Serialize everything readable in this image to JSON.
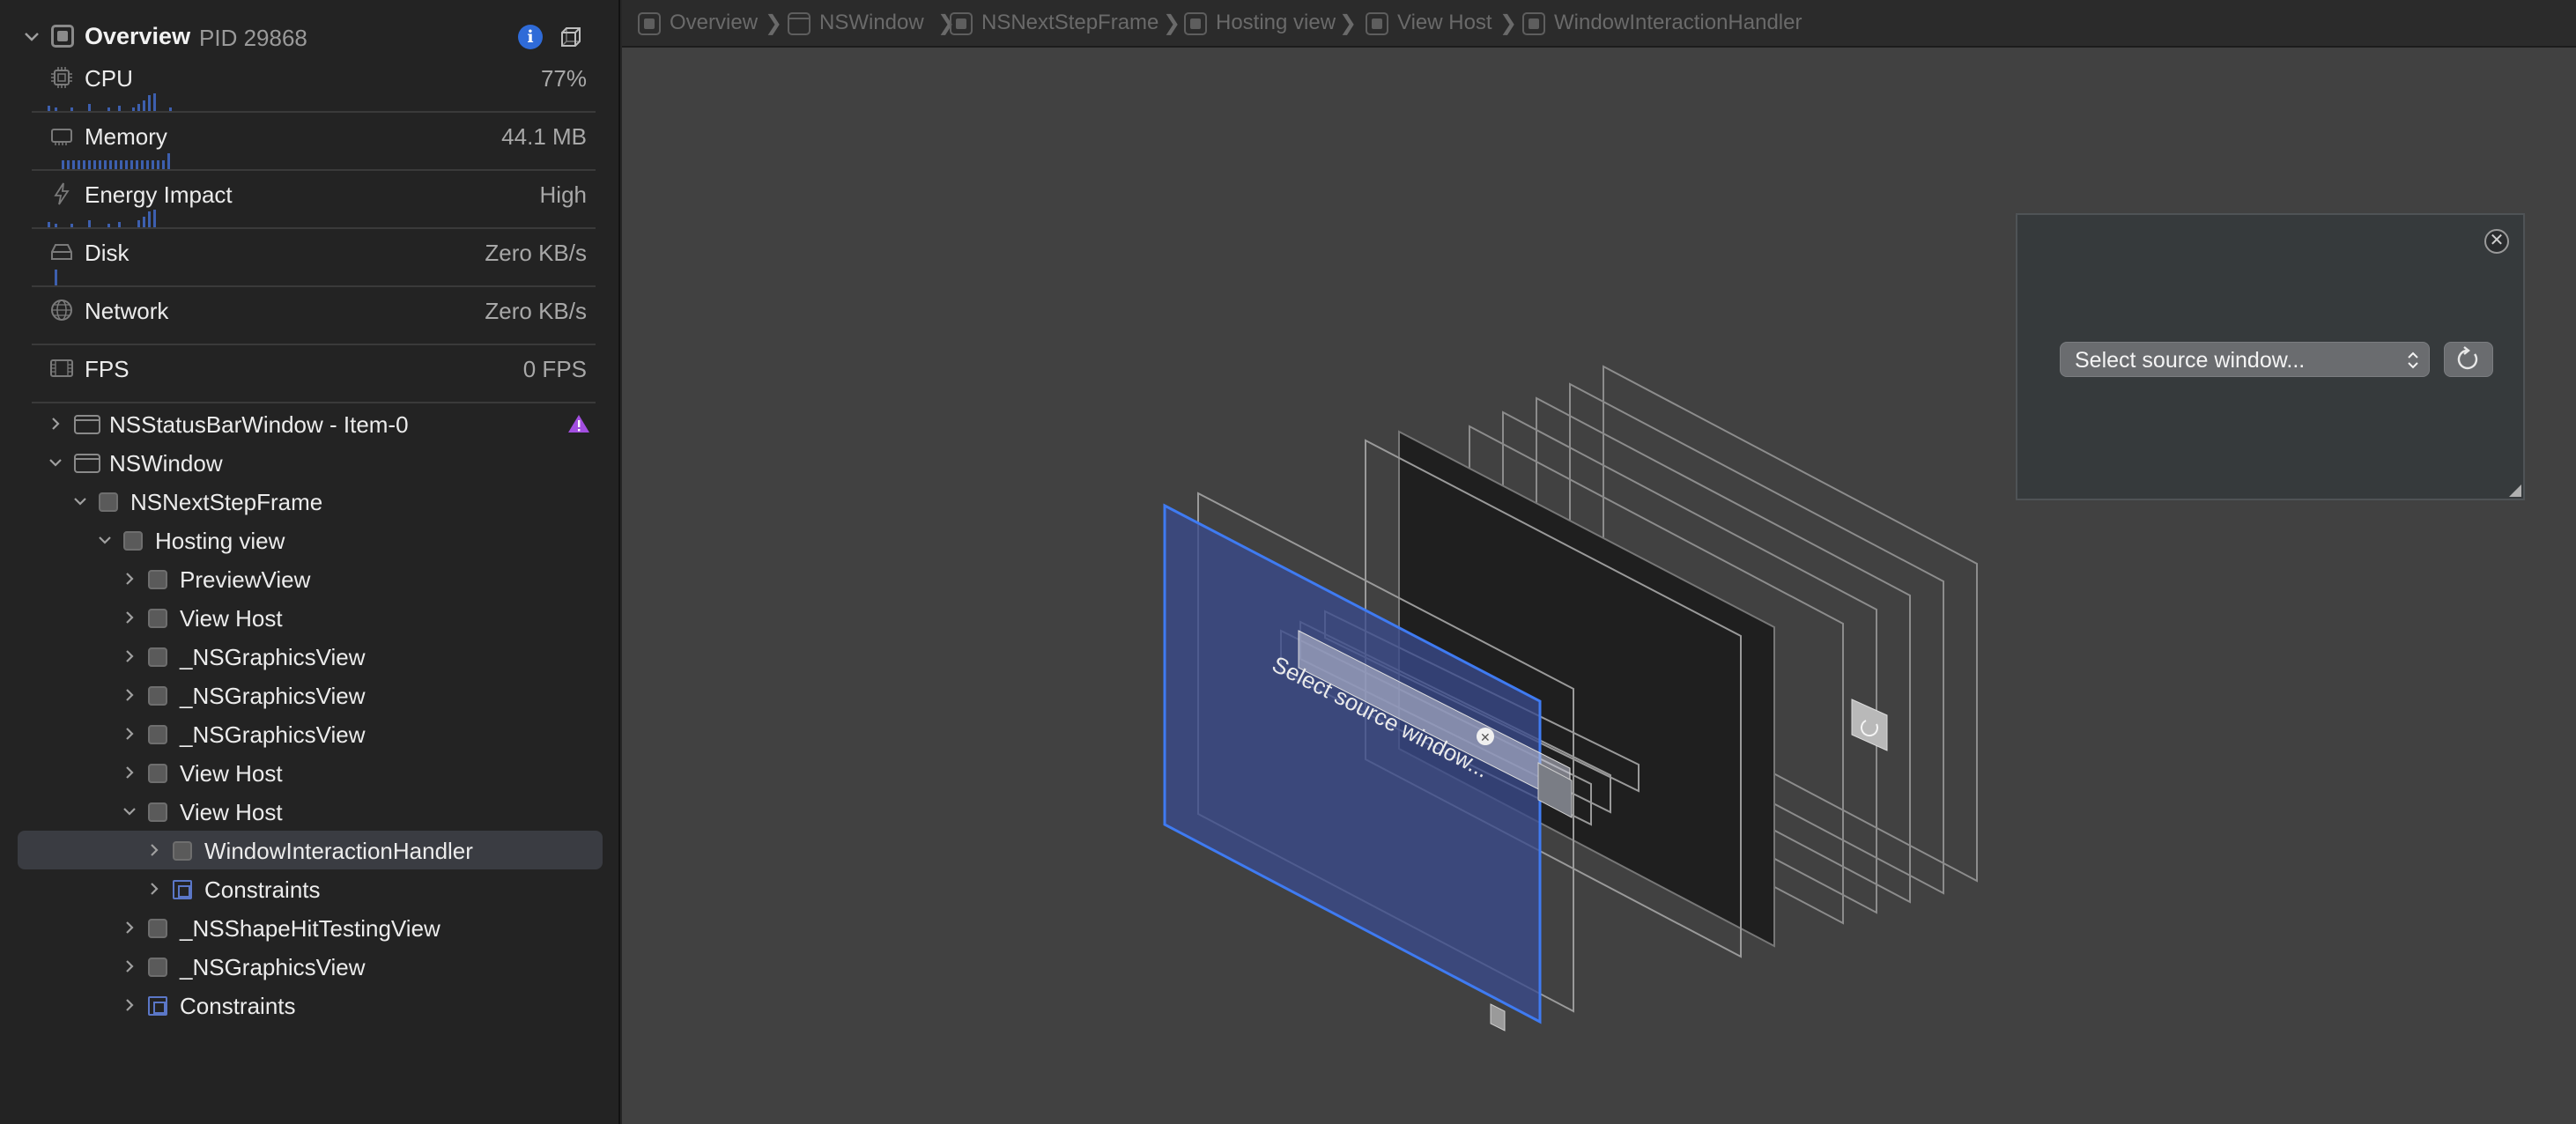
{
  "overview": {
    "title": "Overview",
    "pid": "PID 29868"
  },
  "gauges": [
    {
      "label": "CPU",
      "value": "77%",
      "icon": "cpu-icon"
    },
    {
      "label": "Memory",
      "value": "44.1 MB",
      "icon": "memory-icon"
    },
    {
      "label": "Energy Impact",
      "value": "High",
      "icon": "energy-icon"
    },
    {
      "label": "Disk",
      "value": "Zero KB/s",
      "icon": "disk-icon"
    },
    {
      "label": "Network",
      "value": "Zero KB/s",
      "icon": "network-icon"
    },
    {
      "label": "FPS",
      "value": "0 FPS",
      "icon": "fps-icon"
    }
  ],
  "tree": [
    {
      "label": "NSStatusBarWindow - Item-0",
      "expanded": false,
      "kind": "window",
      "warning": true
    },
    {
      "label": "NSWindow",
      "expanded": true,
      "kind": "window"
    },
    {
      "label": "NSNextStepFrame",
      "expanded": true,
      "kind": "view"
    },
    {
      "label": "Hosting view",
      "expanded": true,
      "kind": "view"
    },
    {
      "label": "PreviewView",
      "expanded": false,
      "kind": "view"
    },
    {
      "label": "View Host",
      "expanded": false,
      "kind": "view"
    },
    {
      "label": "_NSGraphicsView",
      "expanded": false,
      "kind": "view"
    },
    {
      "label": "_NSGraphicsView",
      "expanded": false,
      "kind": "view"
    },
    {
      "label": "_NSGraphicsView",
      "expanded": false,
      "kind": "view"
    },
    {
      "label": "View Host",
      "expanded": false,
      "kind": "view"
    },
    {
      "label": "View Host",
      "expanded": true,
      "kind": "view"
    },
    {
      "label": "WindowInteractionHandler",
      "expanded": false,
      "kind": "view",
      "selected": true
    },
    {
      "label": "Constraints",
      "expanded": false,
      "kind": "constraints"
    },
    {
      "label": "_NSShapeHitTestingView",
      "expanded": false,
      "kind": "view"
    },
    {
      "label": "_NSGraphicsView",
      "expanded": false,
      "kind": "view"
    },
    {
      "label": "Constraints",
      "expanded": false,
      "kind": "constraints"
    }
  ],
  "breadcrumb": [
    "Overview",
    "NSWindow",
    "NSNextStepFrame",
    "Hosting view",
    "View Host",
    "WindowInteractionHandler"
  ],
  "preview": {
    "select_label": "Select source window...",
    "layer_label": "Select source window..."
  },
  "colors": {
    "accent": "#2f6bd8",
    "selection": "#3a3c42",
    "highlight_layer": "#3a4a8c",
    "warning": "#a24ee0"
  }
}
